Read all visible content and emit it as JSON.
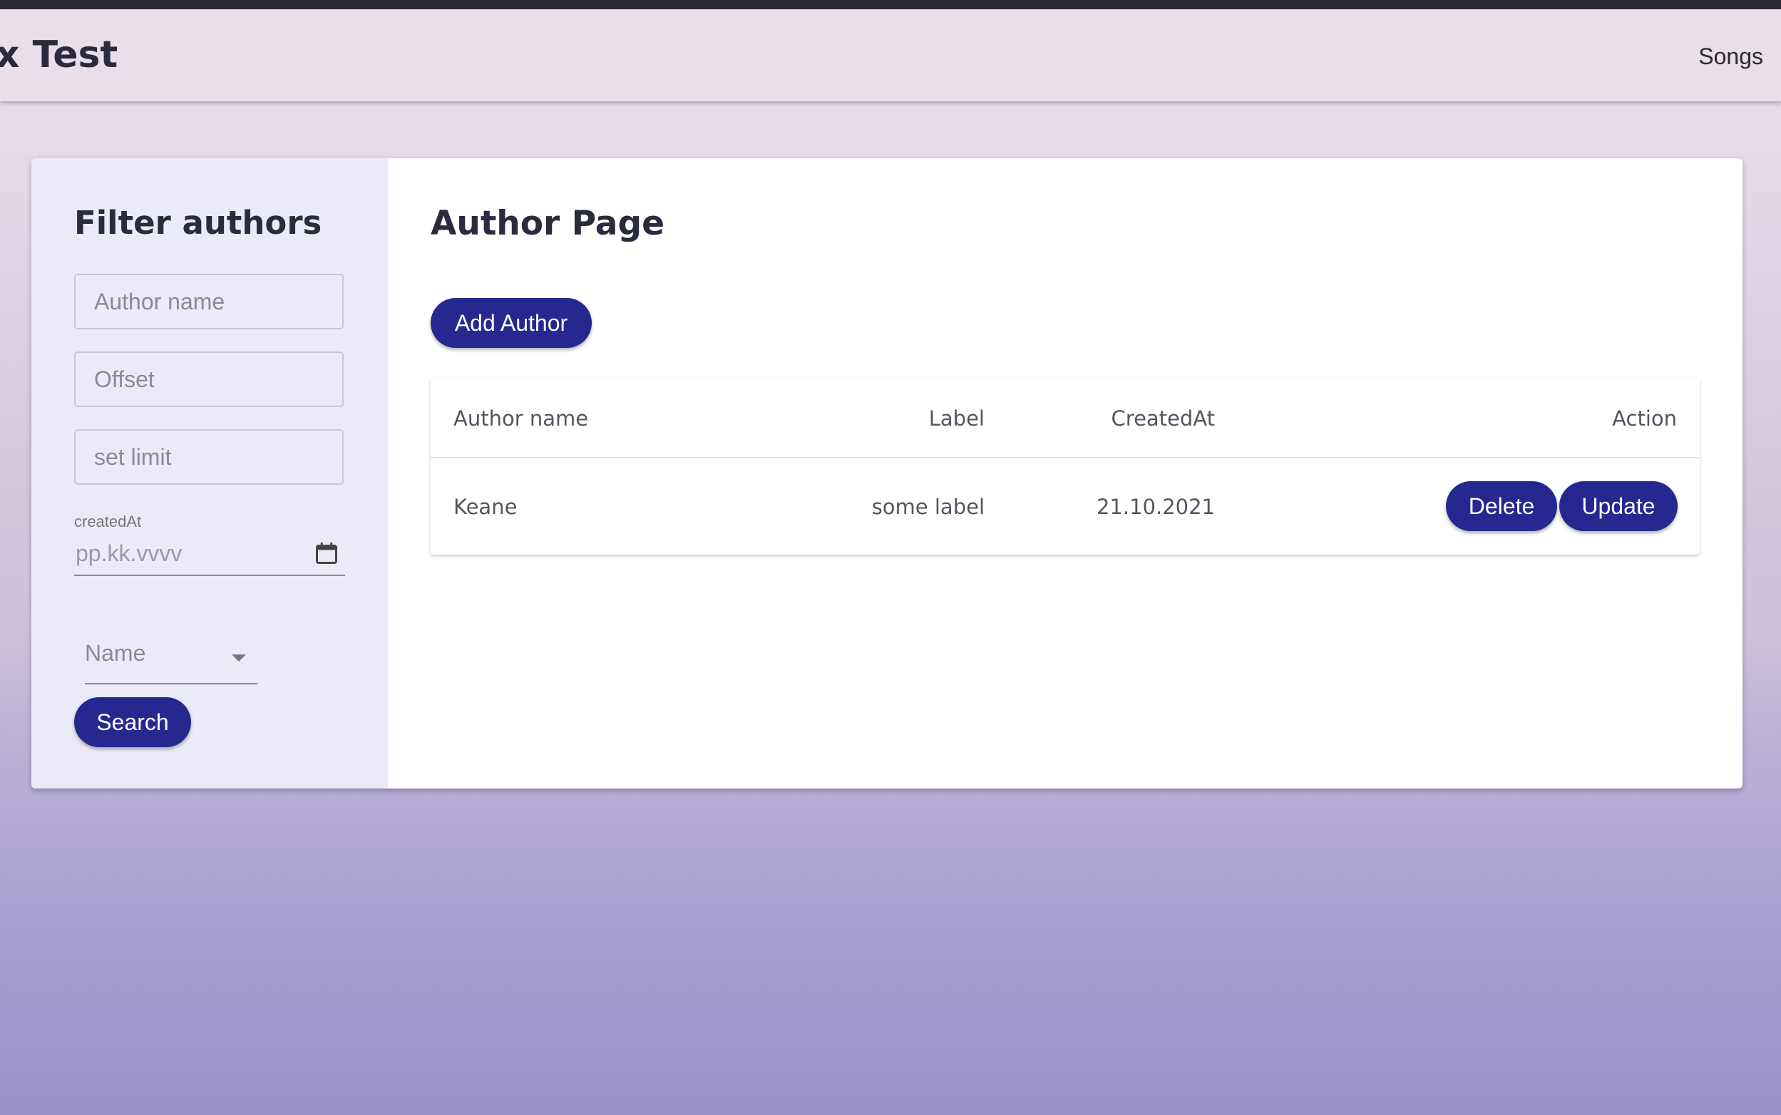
{
  "navbar": {
    "brand": "x Test",
    "links": [
      "Songs"
    ]
  },
  "sidebar": {
    "title": "Filter authors",
    "author_name_placeholder": "Author name",
    "offset_placeholder": "Offset",
    "limit_placeholder": "set limit",
    "date_label": "createdAt",
    "date_placeholder": "pp.kk.vvvv",
    "sort_select_value": "Name",
    "search_button": "Search"
  },
  "main": {
    "title": "Author Page",
    "add_button": "Add Author",
    "table": {
      "headers": [
        "Author name",
        "Label",
        "CreatedAt",
        "Action"
      ],
      "rows": [
        {
          "author_name": "Keane",
          "label": "some label",
          "created_at": "21.10.2021",
          "delete": "Delete",
          "update": "Update"
        }
      ]
    }
  },
  "colors": {
    "accent": "#25288e",
    "navbar": "#eadfe8",
    "sidebar": "#ebebf7",
    "text": "#2b2b3f"
  },
  "icons": {
    "date_picker": "calendar-icon",
    "select": "chevron-down-icon"
  }
}
